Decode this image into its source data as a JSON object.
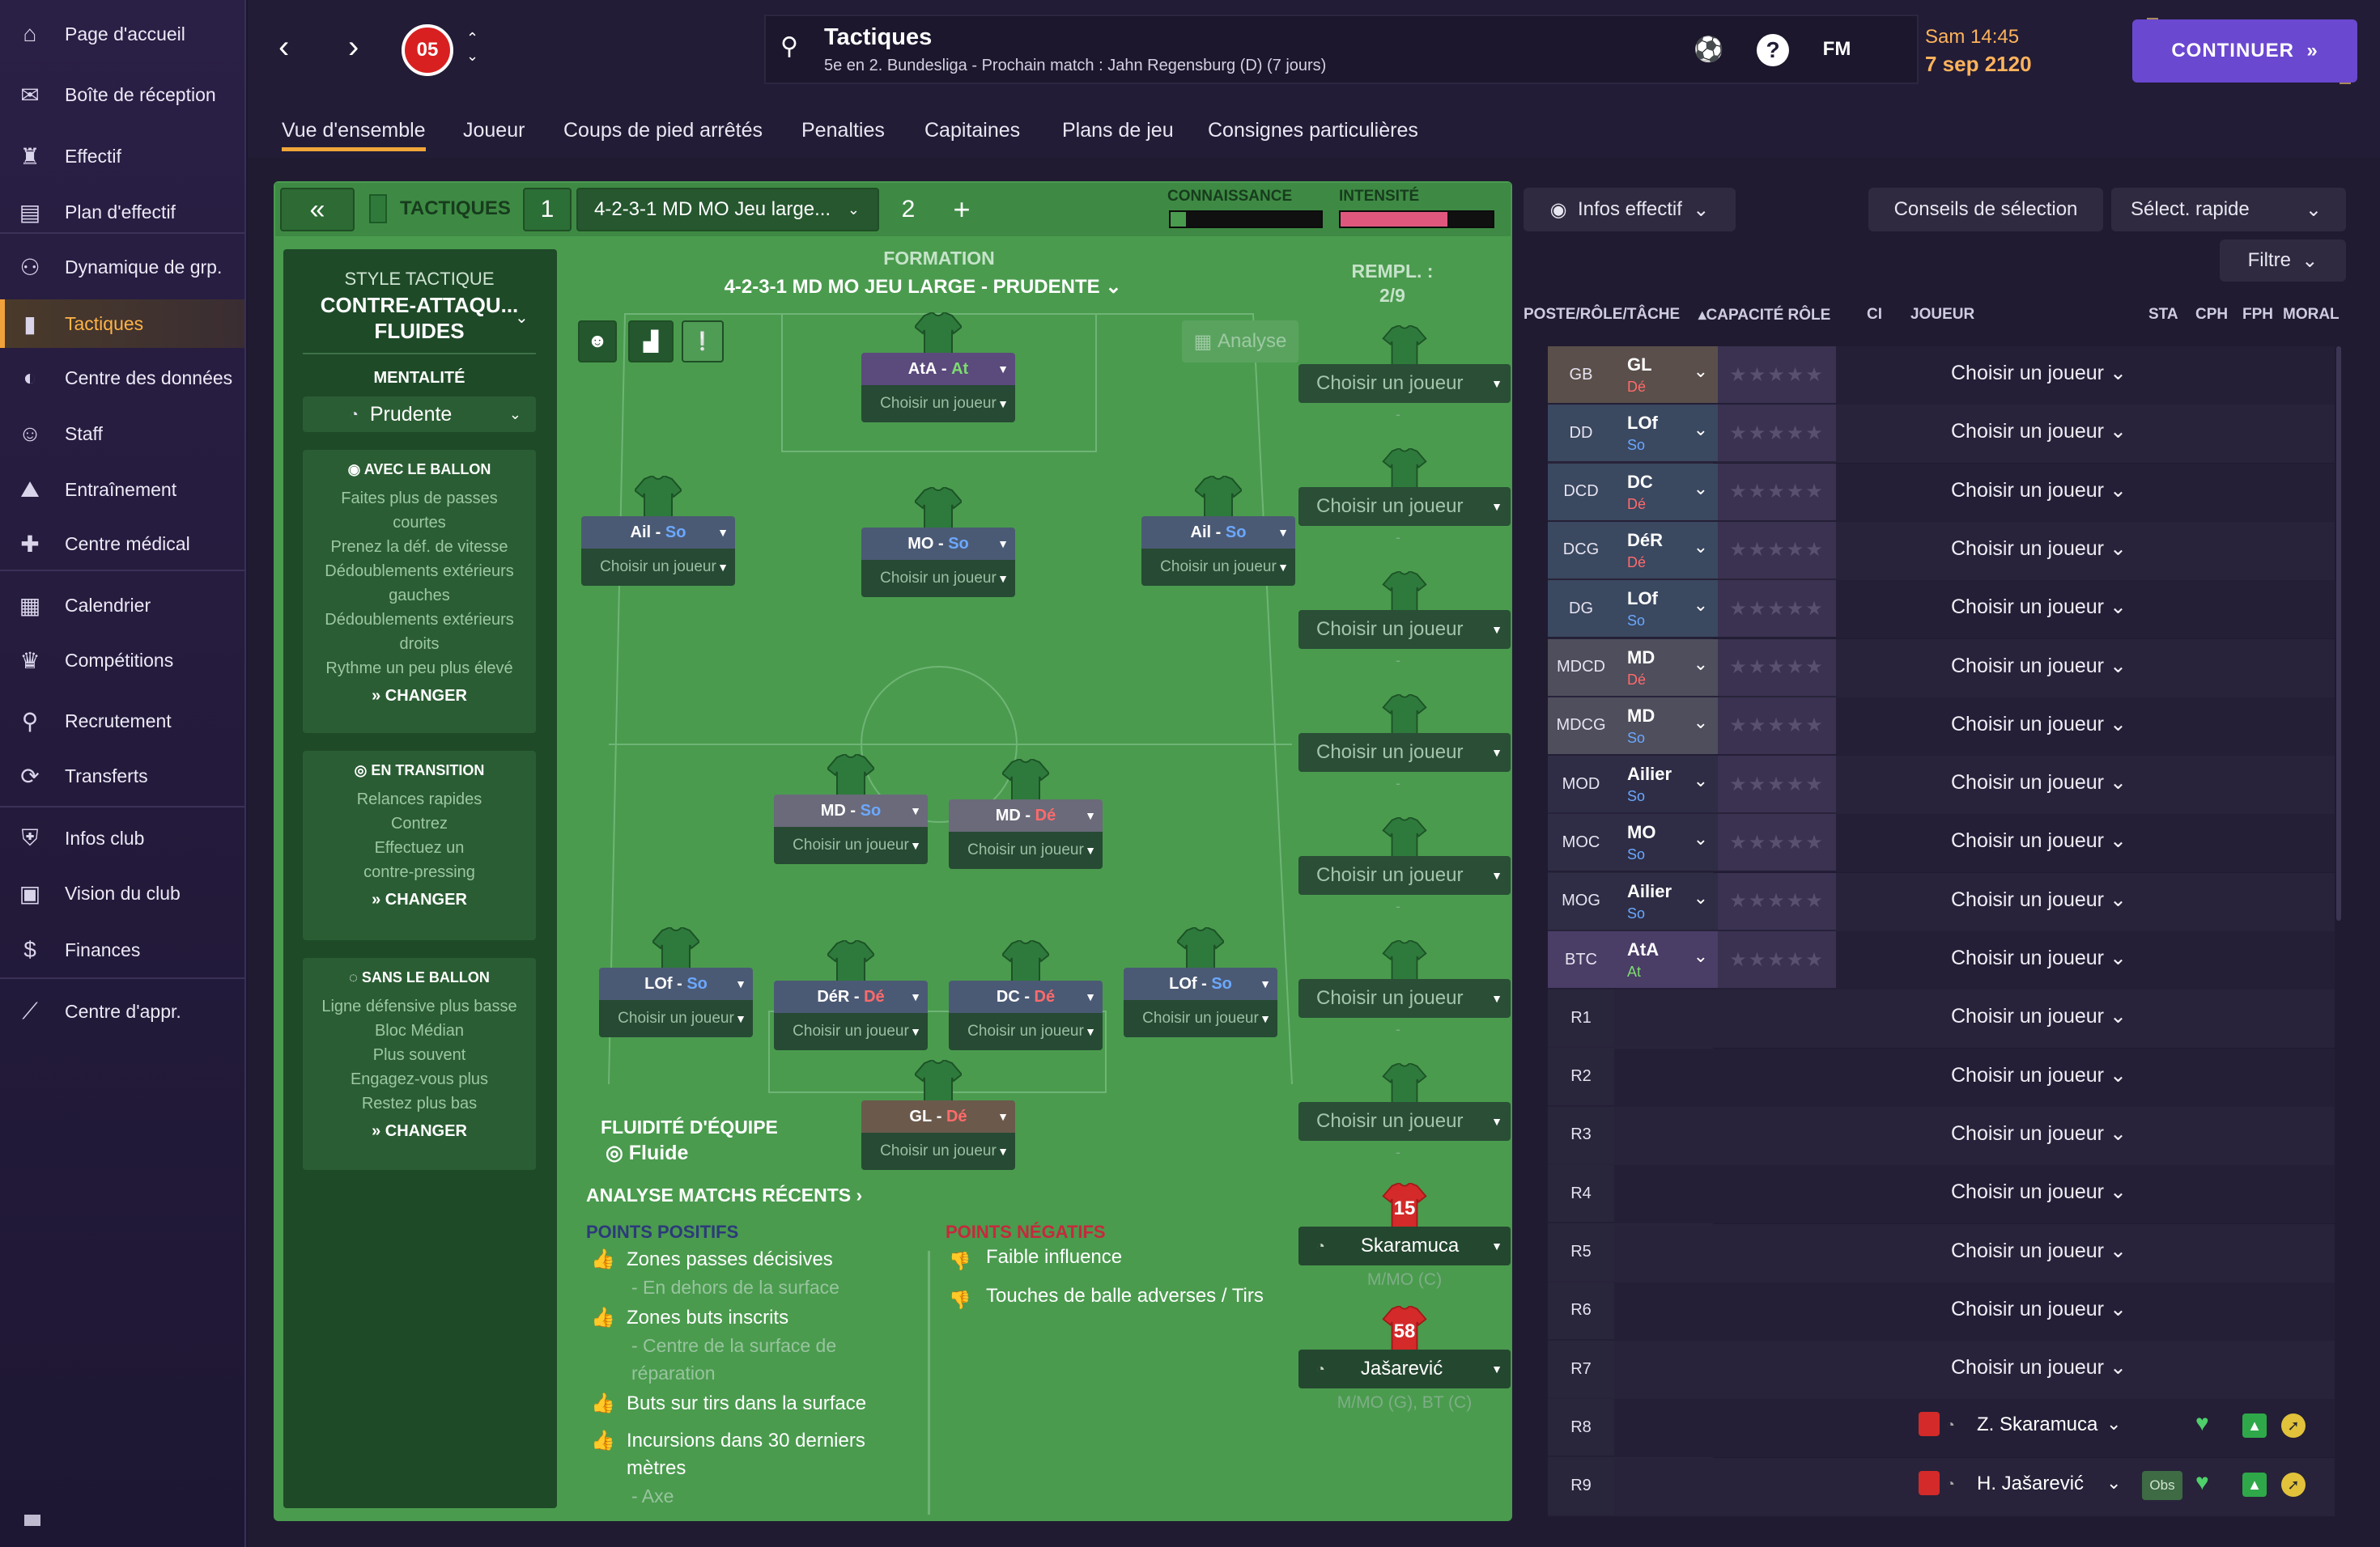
{
  "sidebar": {
    "items": [
      {
        "label": "Page d'accueil",
        "icon": "home-icon"
      },
      {
        "label": "Boîte de réception",
        "icon": "inbox-icon"
      },
      {
        "label": "Effectif",
        "icon": "shirt-icon"
      },
      {
        "label": "Plan d'effectif",
        "icon": "clipboard-icon"
      },
      {
        "label": "Dynamique de grp.",
        "icon": "group-icon"
      },
      {
        "label": "Tactiques",
        "icon": "tactics-icon"
      },
      {
        "label": "Centre des données",
        "icon": "data-icon"
      },
      {
        "label": "Staff",
        "icon": "staff-icon"
      },
      {
        "label": "Entraînement",
        "icon": "training-icon"
      },
      {
        "label": "Centre médical",
        "icon": "medical-icon"
      },
      {
        "label": "Calendrier",
        "icon": "calendar-icon"
      },
      {
        "label": "Compétitions",
        "icon": "trophy-icon"
      },
      {
        "label": "Recrutement",
        "icon": "search-icon"
      },
      {
        "label": "Transferts",
        "icon": "transfer-icon"
      },
      {
        "label": "Infos club",
        "icon": "shield-icon"
      },
      {
        "label": "Vision du club",
        "icon": "briefcase-icon"
      },
      {
        "label": "Finances",
        "icon": "money-icon"
      },
      {
        "label": "Centre d'appr.",
        "icon": "chart-line-icon"
      }
    ]
  },
  "header": {
    "title": "Tactiques",
    "subtitle": "5e en 2. Bundesliga - Prochain match : Jahn Regensburg (D) (7 jours)",
    "help": "?",
    "fm": "FM",
    "time": "Sam 14:45",
    "date": "7 sep 2120",
    "continue": "CONTINUER"
  },
  "tabs": [
    "Vue d'ensemble",
    "Joueur",
    "Coups de pied arrêtés",
    "Penalties",
    "Capitaines",
    "Plans de jeu",
    "Consignes particulières"
  ],
  "tactic_bar": {
    "label": "TACTIQUES",
    "slot1": "1",
    "tactic_name": "4-2-3-1 MD MO Jeu large...",
    "slot2": "2",
    "add": "+",
    "knowledge_label": "CONNAISSANCE",
    "intensity_label": "INTENSITÉ",
    "knowledge_value": 0.1,
    "intensity_value": 0.7
  },
  "style": {
    "label": "STYLE TACTIQUE",
    "name_1": "CONTRE-ATTAQU...",
    "name_2": "FLUIDES",
    "mentality_label": "MENTALITÉ",
    "mentality": "Prudente",
    "with_ball": {
      "title": "AVEC LE BALLON",
      "lines": [
        "Faites plus de passes",
        "courtes",
        "Prenez la déf. de vitesse",
        "Dédoublements extérieurs",
        "gauches",
        "Dédoublements extérieurs",
        "droits",
        "Rythme un peu plus élevé"
      ],
      "change": "CHANGER"
    },
    "transition": {
      "title": "EN TRANSITION",
      "lines": [
        "Relances rapides",
        "Contrez",
        "Effectuez un",
        "contre-pressing"
      ],
      "change": "CHANGER"
    },
    "without_ball": {
      "title": "SANS LE BALLON",
      "lines": [
        "Ligne défensive plus basse",
        "Bloc Médian",
        "Plus souvent",
        "Engagez-vous plus",
        "Restez plus bas"
      ],
      "change": "CHANGER"
    }
  },
  "formation": {
    "label": "FORMATION",
    "name": "4-2-3-1 MD MO JEU LARGE - PRUDENTE",
    "analysis": "Analyse",
    "fluidity_label": "FLUIDITÉ D'ÉQUIPE",
    "fluidity": "Fluide",
    "choose": "Choisir un joueur",
    "players": [
      {
        "role": "AtA",
        "duty": "At",
        "color": "#7cdc6f",
        "bg": "#5b4a7c"
      },
      {
        "role": "Ail",
        "duty": "So",
        "color": "#6ba8ff",
        "bg": "#4b5a74"
      },
      {
        "role": "MO",
        "duty": "So",
        "color": "#6ba8ff",
        "bg": "#4b5a74"
      },
      {
        "role": "Ail",
        "duty": "So",
        "color": "#6ba8ff",
        "bg": "#4b5a74"
      },
      {
        "role": "MD",
        "duty": "So",
        "color": "#6ba8ff",
        "bg": "#6a6a7a"
      },
      {
        "role": "MD",
        "duty": "Dé",
        "color": "#ff6b6b",
        "bg": "#6a6a7a"
      },
      {
        "role": "LOf",
        "duty": "So",
        "color": "#6ba8ff",
        "bg": "#4b5a74"
      },
      {
        "role": "DéR",
        "duty": "Dé",
        "color": "#ff6b6b",
        "bg": "#4b5a74"
      },
      {
        "role": "DC",
        "duty": "Dé",
        "color": "#ff6b6b",
        "bg": "#4b5a74"
      },
      {
        "role": "LOf",
        "duty": "So",
        "color": "#6ba8ff",
        "bg": "#4b5a74"
      },
      {
        "role": "GL",
        "duty": "Dé",
        "color": "#ff6b6b",
        "bg": "#6b5a4c"
      }
    ]
  },
  "subs": {
    "label": "REMPL. :",
    "count": "2/9",
    "choose": "Choisir un joueur",
    "named": [
      {
        "number": "15",
        "name": "Skaramuca",
        "pos": "M/MO (C)"
      },
      {
        "number": "58",
        "name": "Jašarević",
        "pos": "M/MO (G), BT (C)"
      }
    ]
  },
  "analysis": {
    "title": "ANALYSE MATCHS RÉCENTS",
    "positives_label": "POINTS POSITIFS",
    "negatives_label": "POINTS NÉGATIFS",
    "positives": [
      {
        "main": "Zones passes décisives",
        "sub": "- En dehors de la surface"
      },
      {
        "main": "Zones buts inscrits",
        "sub": "- Centre de la surface de réparation"
      },
      {
        "main": "Buts sur tirs dans la surface",
        "sub": ""
      },
      {
        "main": "Incursions dans 30 derniers mètres",
        "sub": "- Axe"
      }
    ],
    "negatives": [
      "Faible influence",
      "Touches de balle adverses / Tirs"
    ]
  },
  "right": {
    "infos": "Infos effectif",
    "conseils": "Conseils de sélection",
    "select": "Sélect. rapide",
    "filtre": "Filtre",
    "headers": {
      "pos": "POSTE/RÔLE/TÂCHE",
      "cap": "CAPACITÉ RÔLE",
      "ci": "CI",
      "player": "JOUEUR",
      "sta": "STA",
      "cph": "CPH",
      "fph": "FPH",
      "moral": "MORAL"
    },
    "choose": "Choisir un joueur",
    "obs": "Obs",
    "rows": [
      {
        "pos": "GB",
        "role": "GL",
        "duty": "Dé",
        "dc": "#ff6b6b",
        "bg": "#5a4f4a"
      },
      {
        "pos": "DD",
        "role": "LOf",
        "duty": "So",
        "dc": "#6ba8ff",
        "bg": "#3a4860"
      },
      {
        "pos": "DCD",
        "role": "DC",
        "duty": "Dé",
        "dc": "#ff6b6b",
        "bg": "#3a4860"
      },
      {
        "pos": "DCG",
        "role": "DéR",
        "duty": "Dé",
        "dc": "#ff6b6b",
        "bg": "#3a4860"
      },
      {
        "pos": "DG",
        "role": "LOf",
        "duty": "So",
        "dc": "#6ba8ff",
        "bg": "#3a4860"
      },
      {
        "pos": "MDCD",
        "role": "MD",
        "duty": "Dé",
        "dc": "#ff6b6b",
        "bg": "#4e4e5c"
      },
      {
        "pos": "MDCG",
        "role": "MD",
        "duty": "So",
        "dc": "#6ba8ff",
        "bg": "#4e4e5c"
      },
      {
        "pos": "MOD",
        "role": "Ailier",
        "duty": "So",
        "dc": "#6ba8ff",
        "bg": "#2e2d45"
      },
      {
        "pos": "MOC",
        "role": "MO",
        "duty": "So",
        "dc": "#6ba8ff",
        "bg": "#2e2d45"
      },
      {
        "pos": "MOG",
        "role": "Ailier",
        "duty": "So",
        "dc": "#6ba8ff",
        "bg": "#2e2d45"
      },
      {
        "pos": "BTC",
        "role": "AtA",
        "duty": "At",
        "dc": "#7cdc6f",
        "bg": "#4a3d66"
      },
      {
        "pos": "R1"
      },
      {
        "pos": "R2"
      },
      {
        "pos": "R3"
      },
      {
        "pos": "R4"
      },
      {
        "pos": "R5"
      },
      {
        "pos": "R6"
      },
      {
        "pos": "R7"
      },
      {
        "pos": "R8",
        "player": "Z. Skaramuca"
      },
      {
        "pos": "R9",
        "player": "H. Jašarević",
        "obs": true
      }
    ]
  }
}
